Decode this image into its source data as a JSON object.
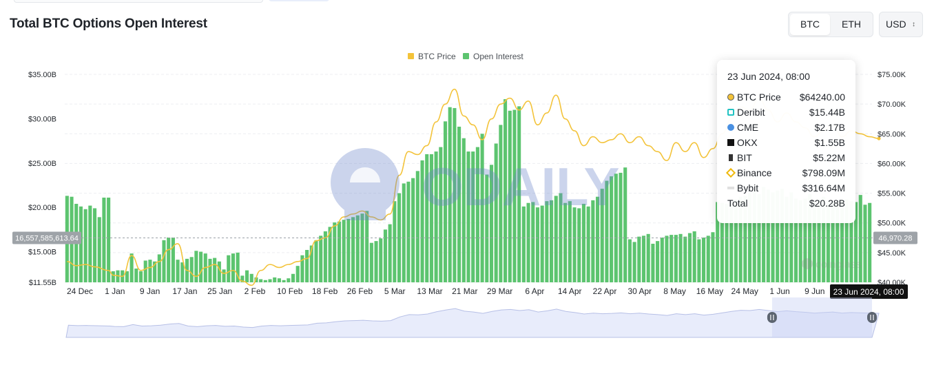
{
  "title": "Total BTC Options Open Interest",
  "asset_toggle": {
    "btc": "BTC",
    "eth": "ETH",
    "selected": "BTC"
  },
  "currency_select": {
    "value": "USD"
  },
  "watermark": {
    "text": "ODAILY",
    "logo": "coinglass"
  },
  "tooltip": {
    "date": "23 Jun 2024, 08:00",
    "rows": [
      {
        "label": "BTC Price",
        "value": "$64240.00",
        "icon": "btc-price-dot-icon"
      },
      {
        "label": "Deribit",
        "value": "$15.44B",
        "icon": "deribit-icon"
      },
      {
        "label": "CME",
        "value": "$2.17B",
        "icon": "cme-icon"
      },
      {
        "label": "OKX",
        "value": "$1.55B",
        "icon": "okx-icon"
      },
      {
        "label": "BIT",
        "value": "$5.22M",
        "icon": "bit-icon"
      },
      {
        "label": "Binance",
        "value": "$798.09M",
        "icon": "binance-icon"
      },
      {
        "label": "Bybit",
        "value": "$316.64M",
        "icon": "bybit-icon"
      }
    ],
    "total": {
      "label": "Total",
      "value": "$20.28B"
    }
  },
  "crosshair": {
    "left_value": "16,557,585,613.64",
    "right_value": "46,970.28",
    "x_value": "23 Jun 2024, 08:00"
  },
  "chart_data": {
    "type": "bar",
    "title": "Total BTC Options Open Interest",
    "legend_position": "top-center",
    "grid": true,
    "colors": {
      "open_interest": "#5cc46f",
      "btc_price": "#f3c33a",
      "navigator_fill": "#e8ecfb",
      "navigator_line": "#b6bfe6"
    },
    "legend": [
      "BTC Price",
      "Open Interest"
    ],
    "x_ticks": [
      "24 Dec",
      "1 Jan",
      "9 Jan",
      "17 Jan",
      "25 Jan",
      "2 Feb",
      "10 Feb",
      "18 Feb",
      "26 Feb",
      "5 Mar",
      "13 Mar",
      "21 Mar",
      "29 Mar",
      "6 Apr",
      "14 Apr",
      "22 Apr",
      "30 Apr",
      "8 May",
      "16 May",
      "24 May",
      "1 Jun",
      "9 Jun"
    ],
    "y_left": {
      "label": "",
      "ticks": [
        "$35.00B",
        "$30.00B",
        "$25.00B",
        "$20.00B",
        "$15.00B",
        "$11.55B"
      ],
      "range": [
        11.55,
        35
      ]
    },
    "y_right": {
      "label": "",
      "ticks": [
        "$75.00K",
        "$70.00K",
        "$65.00K",
        "$60.00K",
        "$55.00K",
        "$50.00K",
        "$45.00K",
        "$40.00K"
      ],
      "range": [
        40,
        75
      ]
    },
    "series": [
      {
        "name": "Open Interest",
        "axis": "left",
        "unit": "B USD",
        "type": "bar",
        "values": [
          21.3,
          21.2,
          20.4,
          20.1,
          19.8,
          20.2,
          19.9,
          18.9,
          21.1,
          21.1,
          12.8,
          12.9,
          12.9,
          12.8,
          14.8,
          13.1,
          12.8,
          14.0,
          14.1,
          13.9,
          14.7,
          16.3,
          16.6,
          16.6,
          14.1,
          13.8,
          14.2,
          14.4,
          15.1,
          15.0,
          14.8,
          14.2,
          14.3,
          13.9,
          13.0,
          14.6,
          14.8,
          14.9,
          12.3,
          12.9,
          12.5,
          12.1,
          11.9,
          11.8,
          11.9,
          12.1,
          12.0,
          11.8,
          12.0,
          12.5,
          13.4,
          14.6,
          15.2,
          15.7,
          16.3,
          16.8,
          17.3,
          17.8,
          18.3,
          18.4,
          18.6,
          18.7,
          18.9,
          19.1,
          19.3,
          19.6,
          16.0,
          16.2,
          16.5,
          17.5,
          18.1,
          20.7,
          21.6,
          22.7,
          22.9,
          23.3,
          24.1,
          25.3,
          26.0,
          26.0,
          26.3,
          26.8,
          29.7,
          31.3,
          31.2,
          29.1,
          27.8,
          26.3,
          26.3,
          26.8,
          28.3,
          23.7,
          24.8,
          27.2,
          29.3,
          32.2,
          30.9,
          31.0,
          31.4,
          20.1,
          20.5,
          20.6,
          20.0,
          20.2,
          20.7,
          20.8,
          21.3,
          21.6,
          20.5,
          20.7,
          20.0,
          19.9,
          20.4,
          20.1,
          20.8,
          21.2,
          22.1,
          23.0,
          23.5,
          23.8,
          23.9,
          24.5,
          16.4,
          16.1,
          16.7,
          16.8,
          17.0,
          15.9,
          16.2,
          16.6,
          16.8,
          16.9,
          16.9,
          17.0,
          16.7,
          17.1,
          17.3,
          16.4,
          16.6,
          16.8,
          17.2,
          20.6,
          20.5,
          20.4,
          20.6,
          20.9,
          21.2,
          21.3,
          21.6,
          21.9,
          21.5,
          22.3,
          22.0,
          21.7,
          21.9,
          22.1,
          21.2,
          21.7,
          21.0,
          20.8,
          21.0,
          21.5,
          20.6,
          20.9,
          21.2,
          20.7,
          20.6,
          20.6,
          20.8,
          20.9,
          20.7,
          20.6,
          21.4,
          20.3,
          20.5
        ]
      },
      {
        "name": "BTC Price",
        "axis": "right",
        "unit": "K USD",
        "type": "line",
        "x_index": [
          0,
          2,
          4,
          6,
          9,
          10,
          12,
          14,
          16,
          18,
          20,
          22,
          24,
          26,
          28,
          30,
          32,
          34,
          36,
          38,
          40,
          42,
          44,
          46,
          48,
          50,
          52,
          54,
          56,
          58,
          60,
          62,
          64,
          66,
          68,
          70,
          72,
          74,
          76,
          78,
          80,
          82,
          84,
          86,
          88,
          90,
          92,
          94,
          96,
          98,
          100,
          102,
          104,
          106,
          108,
          110,
          112,
          114,
          116,
          118,
          120,
          122,
          124,
          126,
          128,
          130,
          132,
          134,
          136,
          138,
          140,
          142,
          144,
          146,
          148,
          150,
          152,
          154,
          156,
          158,
          160,
          162,
          164,
          166,
          168,
          170,
          172,
          174,
          176
        ],
        "values": [
          43.5,
          42.8,
          43.0,
          42.6,
          42.0,
          41.2,
          41.0,
          44.5,
          42.0,
          42.5,
          43.5,
          45.5,
          46.5,
          42.0,
          41.0,
          42.5,
          43.0,
          41.5,
          42.0,
          40.2,
          39.5,
          42.0,
          43.0,
          42.5,
          43.0,
          43.5,
          44.0,
          47.0,
          47.5,
          49.5,
          51.0,
          51.5,
          52.0,
          51.0,
          50.5,
          51.5,
          58.0,
          62.0,
          61.5,
          63.0,
          67.0,
          70.0,
          72.5,
          68.0,
          66.5,
          64.0,
          67.5,
          70.0,
          71.0,
          69.0,
          70.5,
          66.5,
          68.5,
          71.5,
          67.5,
          65.5,
          63.0,
          64.5,
          63.5,
          64.0,
          65.0,
          63.5,
          64.5,
          63.0,
          62.0,
          60.5,
          63.5,
          62.0,
          63.5,
          61.0,
          62.5,
          65.0,
          67.5,
          69.5,
          69.0,
          71.0,
          69.0,
          67.0,
          68.5,
          67.0,
          66.0,
          64.5,
          65.5,
          66.5,
          64.5,
          65.5,
          65.0,
          64.5,
          64.2
        ]
      }
    ],
    "navigator": {
      "type": "area",
      "selected_range": [
        0.876,
        1.0
      ]
    }
  }
}
